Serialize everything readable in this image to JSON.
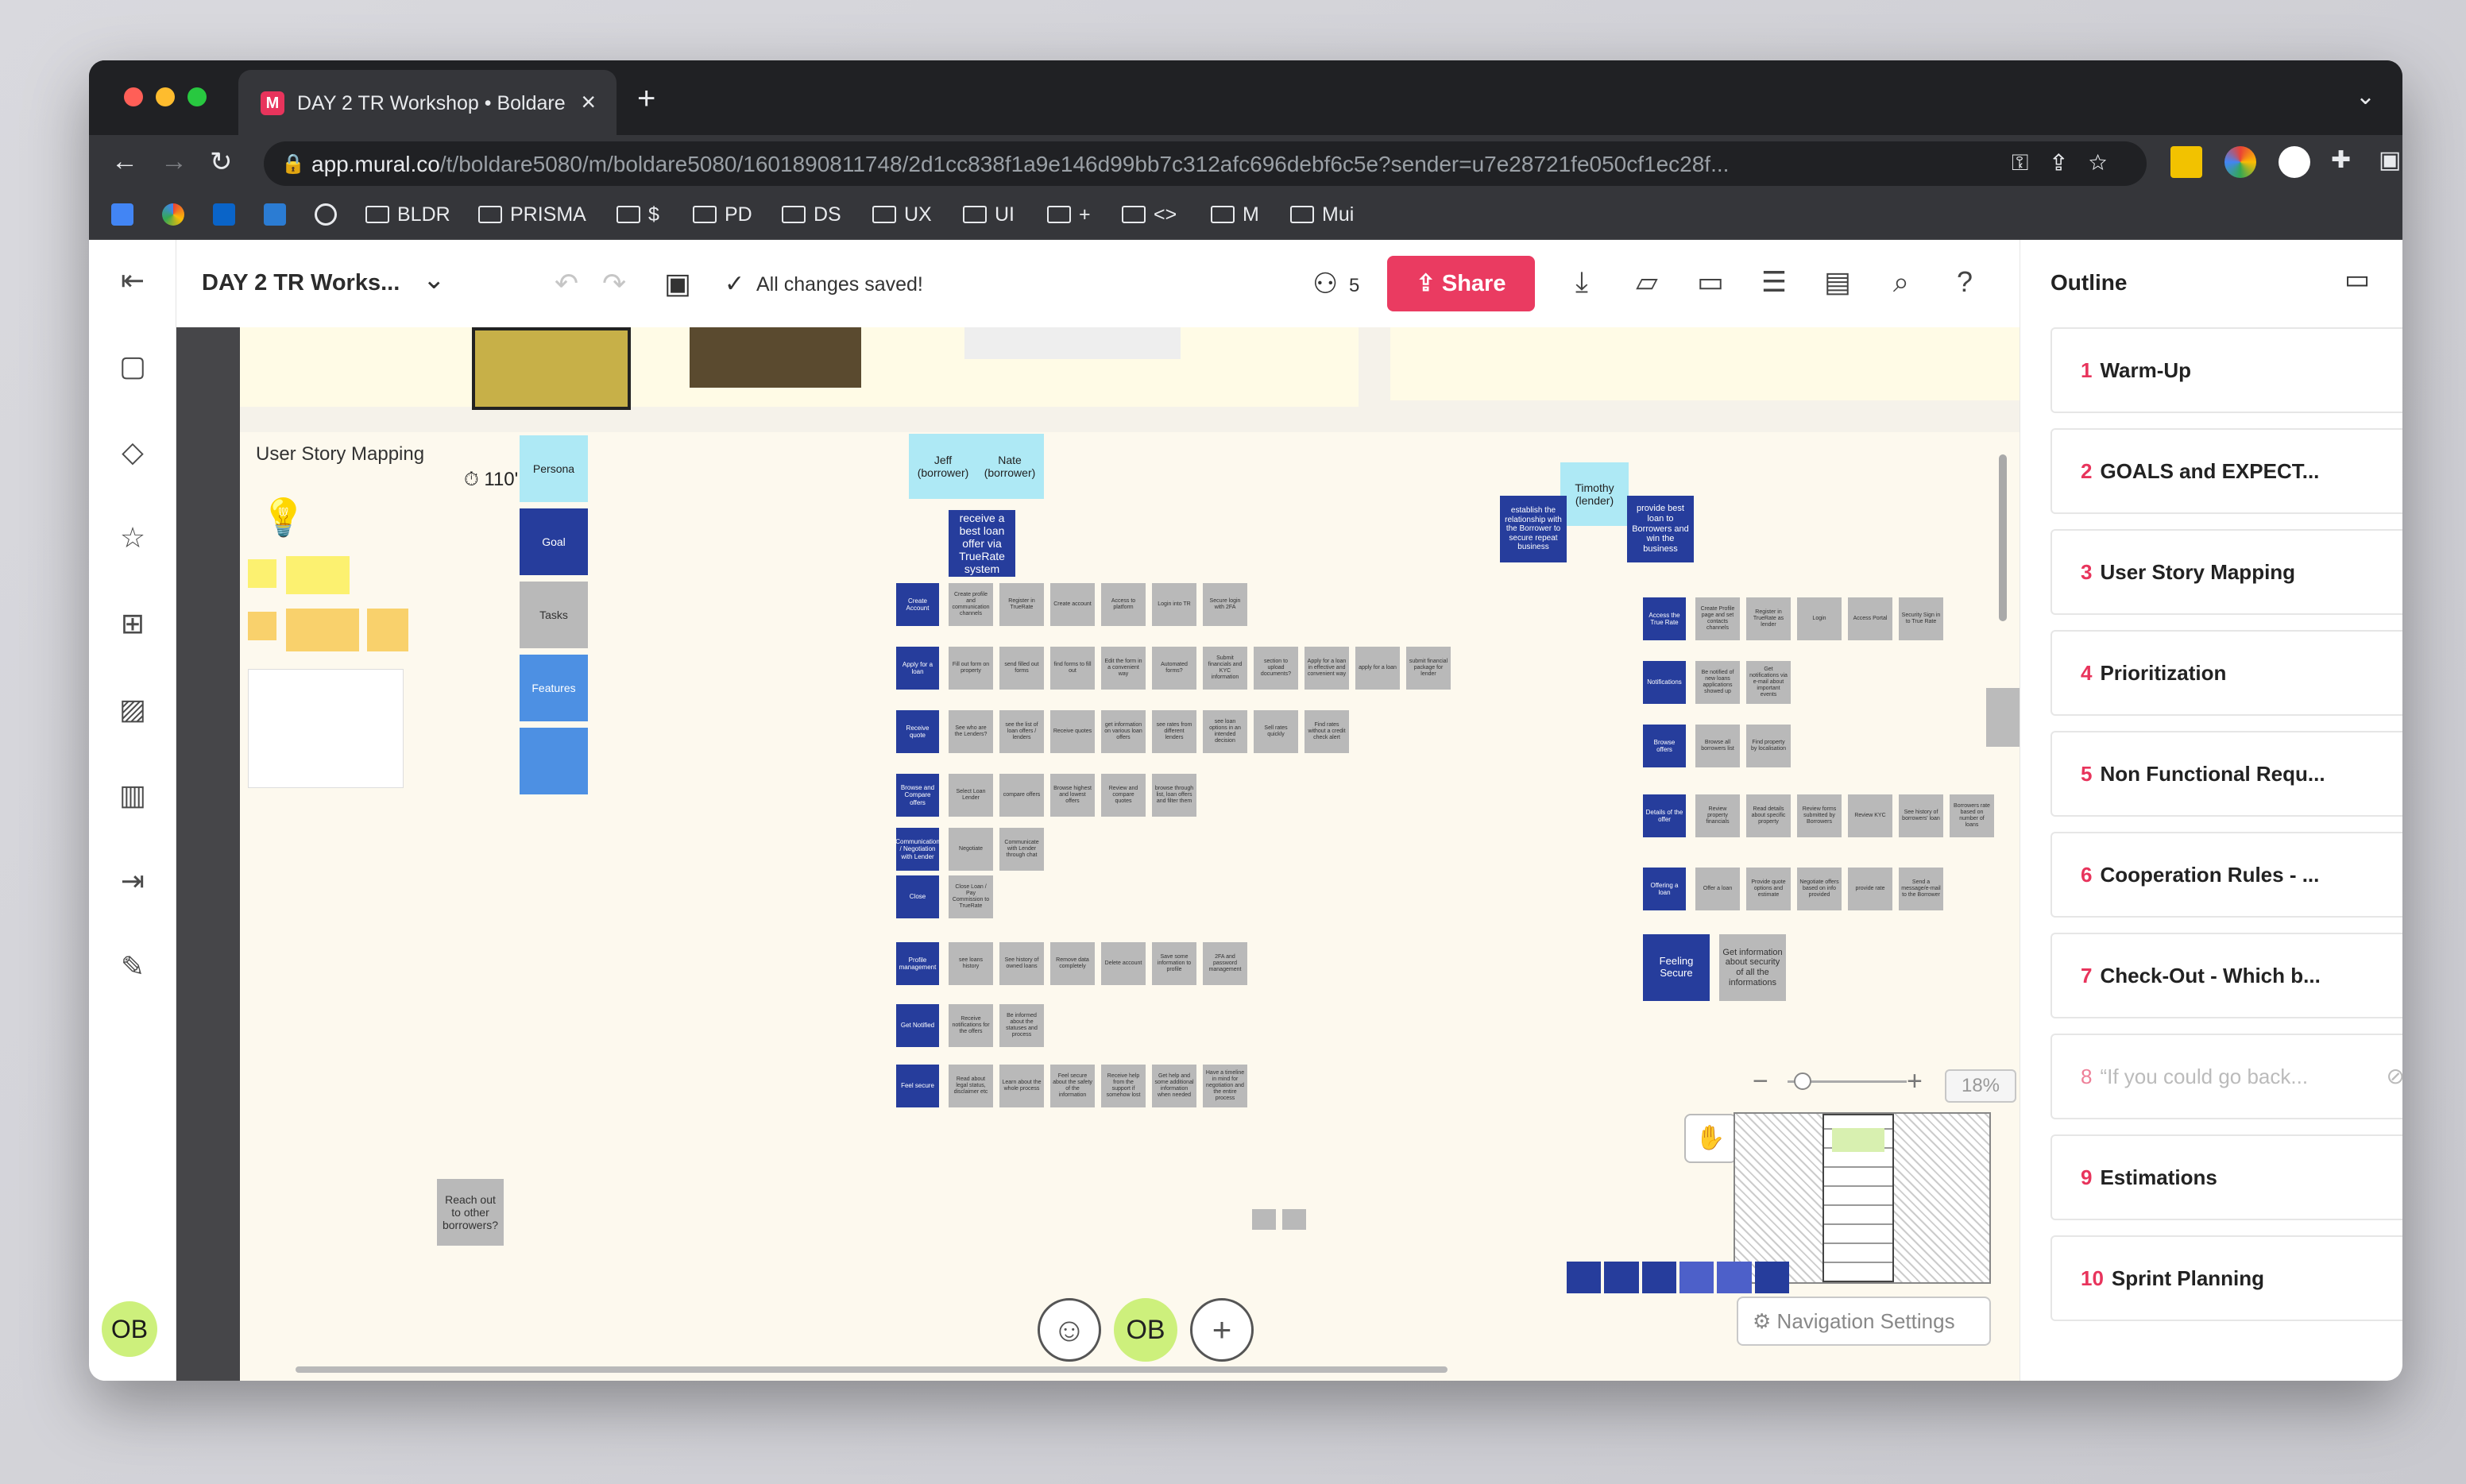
{
  "browser": {
    "tab_title": "DAY 2 TR Workshop • Boldare",
    "tab_favicon": "M",
    "url_domain": "app.mural.co",
    "url_path": "/t/boldare5080/m/boldare5080/1601890811748/2d1cc838f1a9e146d99bb7c312afc696debf6c5e?sender=u7e28721fe050cf1ec28f...",
    "bookmarks": [
      "BLDR",
      "PRISMA",
      "$",
      "PD",
      "DS",
      "UX",
      "UI",
      "+",
      "<>",
      "M",
      "Mui"
    ]
  },
  "toolbar": {
    "mural_title": "DAY 2 TR Works...",
    "save_status": "All changes saved!",
    "collaborator_count": "5",
    "share_label": "Share"
  },
  "user": {
    "initials": "OB"
  },
  "outline": {
    "title": "Outline",
    "items": [
      {
        "num": "1",
        "label": "Warm-Up"
      },
      {
        "num": "2",
        "label": "GOALS and EXPECT..."
      },
      {
        "num": "3",
        "label": "User Story Mapping"
      },
      {
        "num": "4",
        "label": "Prioritization"
      },
      {
        "num": "5",
        "label": "Non Functional Requ..."
      },
      {
        "num": "6",
        "label": "Cooperation Rules - ..."
      },
      {
        "num": "7",
        "label": "Check-Out - Which b..."
      },
      {
        "num": "8",
        "label": "“If you could go back..."
      },
      {
        "num": "9",
        "label": "Estimations"
      },
      {
        "num": "10",
        "label": "Sprint Planning"
      }
    ]
  },
  "board": {
    "section_title": "User Story Mapping",
    "timer": "110'",
    "legend": [
      "Persona",
      "Goal",
      "Tasks",
      "Features"
    ],
    "personas_left": [
      "Jeff (borrower)",
      "Nate (borrower)"
    ],
    "goal_left": "receive a best loan offer via TrueRate system",
    "persona_right": "Timothy (lender)",
    "goals_right": [
      "establish the relationship with the Borrower to secure repeat business",
      "provide best loan to Borrowers and win the business"
    ],
    "reach_out": "Reach out to other borrowers?",
    "left_rows": [
      {
        "head": "Create Account",
        "cells": [
          "Create profile and communication channels",
          "Register in TrueRate",
          "Create account",
          "Access to platform",
          "Login into TR",
          "Secure login with 2FA"
        ]
      },
      {
        "head": "Apply for a loan",
        "cells": [
          "Fill out form on property",
          "send filled out forms",
          "find forms to fill out",
          "Edit the form in a convenient way",
          "Automated forms?",
          "Submit financials and KYC information",
          "section to upload documents?",
          "Apply for a loan in effective and convenient way",
          "apply for a loan",
          "submit financial package for lender"
        ]
      },
      {
        "head": "Receive quote",
        "cells": [
          "See who are the Lenders?",
          "see the list of loan offers / lenders",
          "Receive quotes",
          "get information on various loan offers",
          "see rates from different lenders",
          "see loan options in an intended decision",
          "Sell rates quickly",
          "Find rates without a credit check alert"
        ]
      },
      {
        "head": "Browse and Compare offers",
        "cells": [
          "Select Loan Lender",
          "compare offers",
          "Browse highest and lowest offers",
          "Review and compare quotes",
          "browse through list, loan offers and filter them"
        ]
      },
      {
        "head": "Communication / Negotiation with Lender",
        "cells": [
          "Negotiate",
          "Communicate with Lender through chat"
        ]
      },
      {
        "head": "Close",
        "cells": [
          "Close Loan / Pay Commission to TrueRate"
        ]
      },
      {
        "head": "Profile management",
        "cells": [
          "see loans history",
          "See history of owned loans",
          "Remove data completely",
          "Delete account",
          "Save some information to profile",
          "2FA and password management"
        ]
      },
      {
        "head": "Get Notified",
        "cells": [
          "Receive notifications for the offers",
          "Be informed about the statuses and process"
        ]
      },
      {
        "head": "Feel secure",
        "cells": [
          "Read about legal status, disclaimer etc",
          "Learn about the whole process",
          "Feel secure about the safety of the information",
          "Receive help from the support if somehow lost",
          "Get help and some additional information when needed",
          "Have a timeline in mind for negotiation and the entire process"
        ]
      }
    ],
    "right_rows": [
      {
        "head": "Access the True Rate",
        "cells": [
          "Create Profile page and set contacts channels",
          "Register in TrueRate as lender",
          "Login",
          "Access Portal",
          "Security Sign in to True Rate"
        ]
      },
      {
        "head": "Notifications",
        "cells": [
          "Be notified of new loans applications showed up",
          "Get notifications via e-mail about important events"
        ]
      },
      {
        "head": "Browse offers",
        "cells": [
          "Browse all borrowers list",
          "Find property by localisation"
        ]
      },
      {
        "head": "Details of the offer",
        "cells": [
          "Review property financials",
          "Read details about specific property",
          "Review forms submitted by Borrowers",
          "Review KYC",
          "See history of borrowers' loan",
          "Borrowers rate based on number of loans"
        ]
      },
      {
        "head": "Offering a loan",
        "cells": [
          "Offer a loan",
          "Provide quote options and estimate",
          "Negotiate offers based on info provided",
          "provide rate",
          "Send a message/e-mail to the Borrower"
        ]
      },
      {
        "head": "Feeling Secure",
        "cells": [
          "Get information about security of all the informations"
        ]
      }
    ]
  },
  "zoom": {
    "percent": "18%"
  },
  "navigation_settings": "Navigation Settings"
}
